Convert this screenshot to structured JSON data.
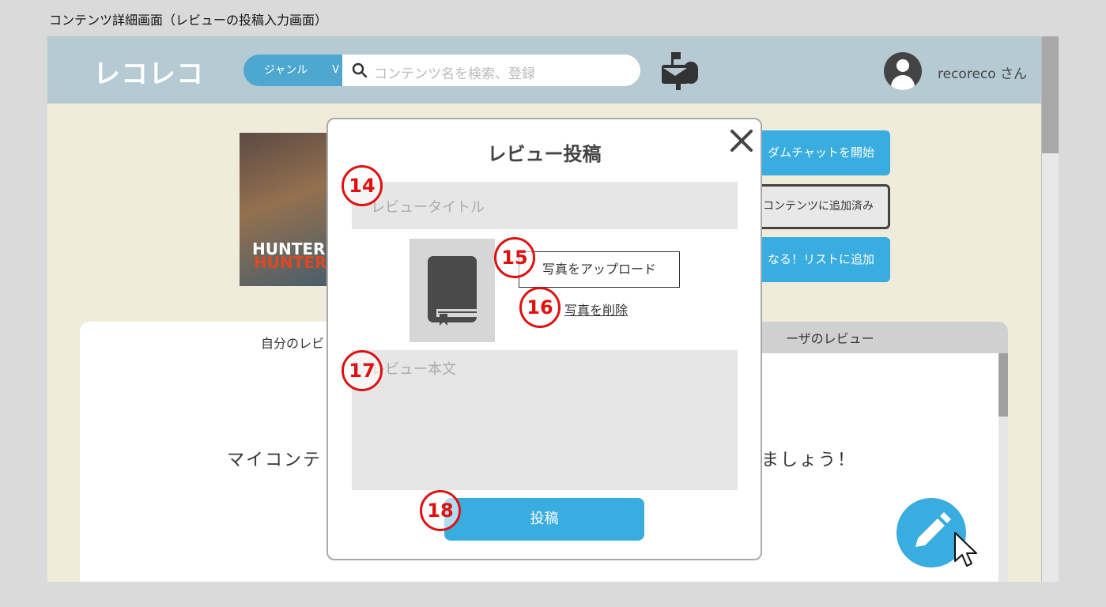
{
  "caption": "コンテンツ詳細画面（レビューの投稿入力画面）",
  "header": {
    "logo": "レコレコ",
    "genre_label": "ジャンル",
    "genre_chevron": "V",
    "search_placeholder": "コンテンツ名を検索、登録",
    "username": "recoreco さん"
  },
  "poster": {
    "title_line1": "HUNTER",
    "title_line2": "HUNTER"
  },
  "side_buttons": {
    "chat": "ダムチャットを開始",
    "added": "コンテンツに追加済み",
    "list": "なる！リストに追加"
  },
  "reviews": {
    "tab_left": "自分のレビ",
    "tab_right": "ーザのレビュー",
    "empty_left": "マイコンテ",
    "empty_right": "ましょう！"
  },
  "modal": {
    "title": "レビュー投稿",
    "title_placeholder": "レビュータイトル",
    "upload_label": "写真をアップロード",
    "delete_label": "写真を削除",
    "body_placeholder": "レビュー本文",
    "post_label": "投稿"
  },
  "annotations": [
    "14",
    "15",
    "16",
    "17",
    "18"
  ],
  "colors": {
    "header_bg": "#b5cad3",
    "page_bg": "#f0ecdb",
    "accent": "#39ace0",
    "annotation": "#e01010"
  }
}
